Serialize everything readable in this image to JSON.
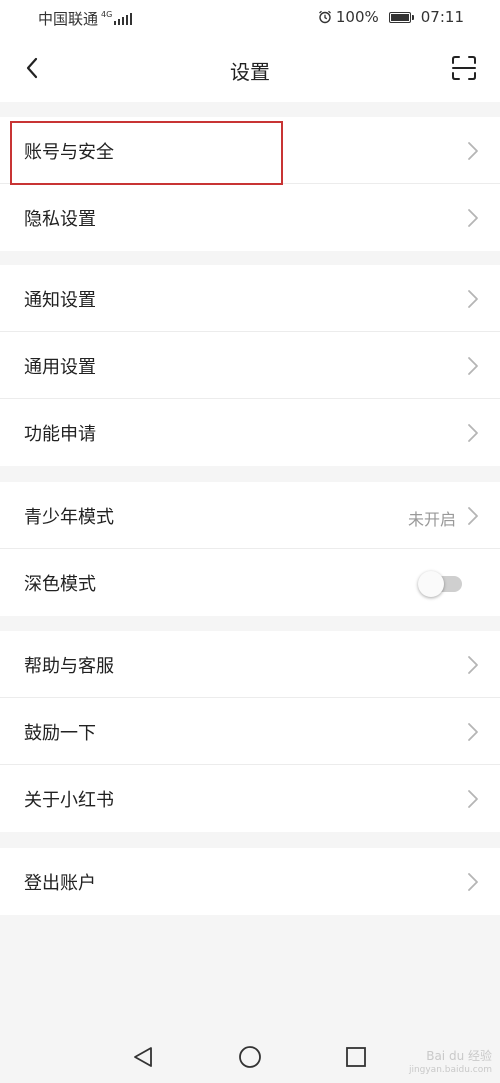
{
  "status_bar": {
    "carrier": "中国联通",
    "network_type": "4G",
    "battery_percent": "100%",
    "battery_level": 1.0,
    "time": "07:11"
  },
  "header": {
    "title": "设置",
    "back_icon": "chevron-left-icon",
    "scan_icon": "scan-icon"
  },
  "groups": [
    {
      "items": [
        {
          "label": "账号与安全",
          "highlighted": true
        },
        {
          "label": "隐私设置"
        }
      ]
    },
    {
      "items": [
        {
          "label": "通知设置"
        },
        {
          "label": "通用设置"
        },
        {
          "label": "功能申请"
        }
      ]
    },
    {
      "items": [
        {
          "label": "青少年模式",
          "value": "未开启"
        },
        {
          "label": "深色模式",
          "toggle_on": false
        }
      ]
    },
    {
      "items": [
        {
          "label": "帮助与客服"
        },
        {
          "label": "鼓励一下"
        },
        {
          "label": "关于小红书"
        }
      ]
    },
    {
      "items": [
        {
          "label": "登出账户"
        }
      ]
    }
  ],
  "colors": {
    "highlight_border": "#c83434",
    "chevron": "#b5b5b5",
    "background": "#f5f5f5"
  },
  "watermark": {
    "line1": "Bai du 经验",
    "line2": "jingyan.baidu.com"
  }
}
